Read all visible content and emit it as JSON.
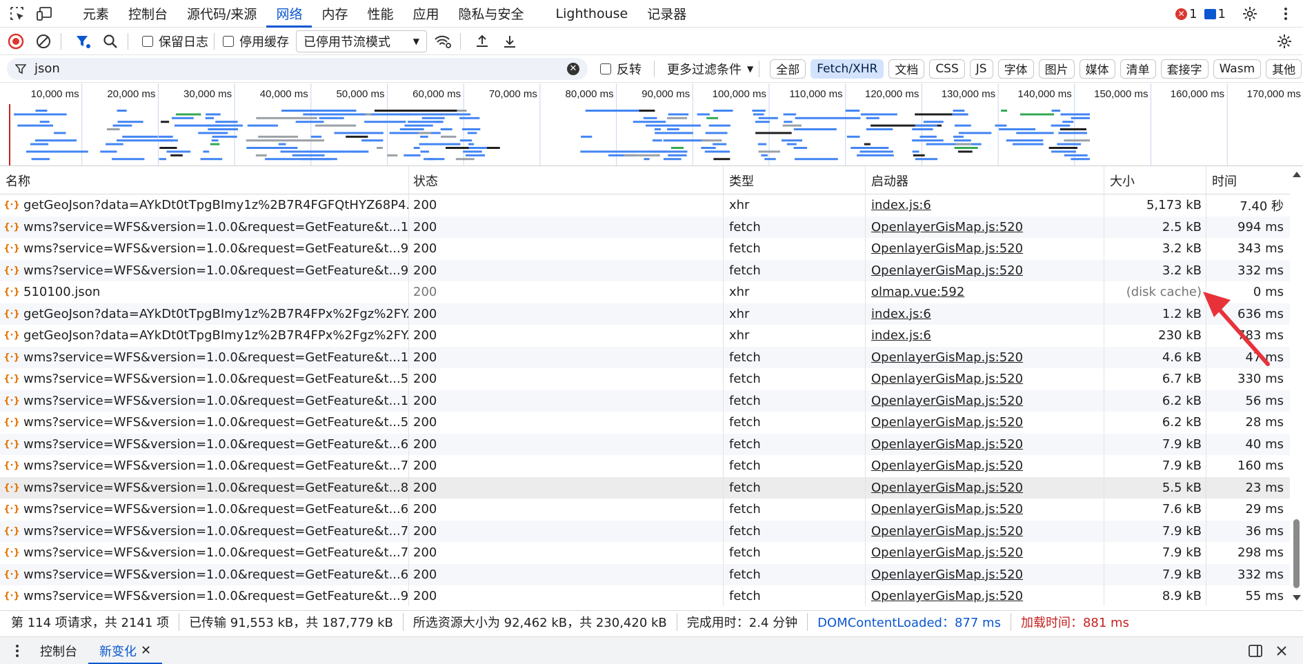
{
  "topbar": {
    "tabs": [
      "元素",
      "控制台",
      "源代码/来源",
      "网络",
      "内存",
      "性能",
      "应用",
      "隐私与安全",
      "Lighthouse",
      "记录器"
    ],
    "active_tab": 3,
    "errors": "1",
    "messages": "1"
  },
  "toolbar": {
    "preserve_log": "保留日志",
    "disable_cache": "停用缓存",
    "throttle": "已停用节流模式"
  },
  "filter": {
    "value": "json",
    "invert": "反转",
    "more_filters": "更多过滤条件",
    "chips": [
      "全部",
      "Fetch/XHR",
      "文档",
      "CSS",
      "JS",
      "字体",
      "图片",
      "媒体",
      "清单",
      "套接字",
      "Wasm",
      "其他"
    ],
    "selected_chip": 1
  },
  "overview": {
    "ticks": [
      "10,000 ms",
      "20,000 ms",
      "30,000 ms",
      "40,000 ms",
      "50,000 ms",
      "60,000 ms",
      "70,000 ms",
      "80,000 ms",
      "90,000 ms",
      "100,000 ms",
      "110,000 ms",
      "120,000 ms",
      "130,000 ms",
      "140,000 ms",
      "150,000 ms",
      "160,000 ms",
      "170,000 ms"
    ]
  },
  "table": {
    "headers": [
      "名称",
      "状态",
      "类型",
      "启动器",
      "大小",
      "时间"
    ],
    "rows": [
      {
        "name": "getGeoJson?data=AYkDt0tTpgBImy1z%2B7R4FGFQtHYZ68P4...",
        "status": "200",
        "type": "xhr",
        "initiator": "index.js:6",
        "size": "5,173 kB",
        "time": "7.40 秒"
      },
      {
        "name": "wms?service=WFS&version=1.0.0&request=GetFeature&t...1...",
        "status": "200",
        "type": "fetch",
        "initiator": "OpenlayerGisMap.js:520",
        "size": "2.5 kB",
        "time": "994 ms"
      },
      {
        "name": "wms?service=WFS&version=1.0.0&request=GetFeature&t...9...",
        "status": "200",
        "type": "fetch",
        "initiator": "OpenlayerGisMap.js:520",
        "size": "3.2 kB",
        "time": "343 ms"
      },
      {
        "name": "wms?service=WFS&version=1.0.0&request=GetFeature&t...9...",
        "status": "200",
        "type": "fetch",
        "initiator": "OpenlayerGisMap.js:520",
        "size": "3.2 kB",
        "time": "332 ms"
      },
      {
        "name": "510100.json",
        "status": "200",
        "type": "xhr",
        "initiator": "olmap.vue:592",
        "size": "(disk cache)",
        "time": "0 ms"
      },
      {
        "name": "getGeoJson?data=AYkDt0tTpgBImy1z%2B7R4FPx%2Fgz%2FY...",
        "status": "200",
        "type": "xhr",
        "initiator": "index.js:6",
        "size": "1.2 kB",
        "time": "636 ms"
      },
      {
        "name": "getGeoJson?data=AYkDt0tTpgBImy1z%2B7R4FPx%2Fgz%2FY...",
        "status": "200",
        "type": "xhr",
        "initiator": "index.js:6",
        "size": "230 kB",
        "time": "783 ms"
      },
      {
        "name": "wms?service=WFS&version=1.0.0&request=GetFeature&t...1...",
        "status": "200",
        "type": "fetch",
        "initiator": "OpenlayerGisMap.js:520",
        "size": "4.6 kB",
        "time": "47 ms"
      },
      {
        "name": "wms?service=WFS&version=1.0.0&request=GetFeature&t...5...",
        "status": "200",
        "type": "fetch",
        "initiator": "OpenlayerGisMap.js:520",
        "size": "6.7 kB",
        "time": "330 ms"
      },
      {
        "name": "wms?service=WFS&version=1.0.0&request=GetFeature&t...1...",
        "status": "200",
        "type": "fetch",
        "initiator": "OpenlayerGisMap.js:520",
        "size": "6.2 kB",
        "time": "56 ms"
      },
      {
        "name": "wms?service=WFS&version=1.0.0&request=GetFeature&t...5...",
        "status": "200",
        "type": "fetch",
        "initiator": "OpenlayerGisMap.js:520",
        "size": "6.2 kB",
        "time": "28 ms"
      },
      {
        "name": "wms?service=WFS&version=1.0.0&request=GetFeature&t...6...",
        "status": "200",
        "type": "fetch",
        "initiator": "OpenlayerGisMap.js:520",
        "size": "7.9 kB",
        "time": "40 ms"
      },
      {
        "name": "wms?service=WFS&version=1.0.0&request=GetFeature&t...7...",
        "status": "200",
        "type": "fetch",
        "initiator": "OpenlayerGisMap.js:520",
        "size": "7.9 kB",
        "time": "160 ms"
      },
      {
        "name": "wms?service=WFS&version=1.0.0&request=GetFeature&t...8...",
        "status": "200",
        "type": "fetch",
        "initiator": "OpenlayerGisMap.js:520",
        "size": "5.5 kB",
        "time": "23 ms"
      },
      {
        "name": "wms?service=WFS&version=1.0.0&request=GetFeature&t...6...",
        "status": "200",
        "type": "fetch",
        "initiator": "OpenlayerGisMap.js:520",
        "size": "7.6 kB",
        "time": "29 ms"
      },
      {
        "name": "wms?service=WFS&version=1.0.0&request=GetFeature&t...7...",
        "status": "200",
        "type": "fetch",
        "initiator": "OpenlayerGisMap.js:520",
        "size": "7.9 kB",
        "time": "36 ms"
      },
      {
        "name": "wms?service=WFS&version=1.0.0&request=GetFeature&t...7...",
        "status": "200",
        "type": "fetch",
        "initiator": "OpenlayerGisMap.js:520",
        "size": "7.9 kB",
        "time": "298 ms"
      },
      {
        "name": "wms?service=WFS&version=1.0.0&request=GetFeature&t...6...",
        "status": "200",
        "type": "fetch",
        "initiator": "OpenlayerGisMap.js:520",
        "size": "7.9 kB",
        "time": "332 ms"
      },
      {
        "name": "wms?service=WFS&version=1.0.0&request=GetFeature&t...9...",
        "status": "200",
        "type": "fetch",
        "initiator": "OpenlayerGisMap.js:520",
        "size": "8.9 kB",
        "time": "55 ms"
      }
    ]
  },
  "status": {
    "requests": "第 114 项请求，共 2141 项",
    "transferred": "已传输 91,553 kB，共 187,779 kB",
    "resources": "所选资源大小为 92,462 kB，共 230,420 kB",
    "finish": "完成用时：2.4 分钟",
    "domcontentloaded": "DOMContentLoaded：877 ms",
    "load": "加载时间：881 ms"
  },
  "drawer": {
    "tabs": [
      "控制台",
      "新变化"
    ],
    "active_tab": 1
  },
  "colors": {
    "accent": "#0b57d0",
    "error": "#dc362e",
    "annotation_arrow": "#e8323a",
    "waterfall_bar": "#4285f4"
  }
}
